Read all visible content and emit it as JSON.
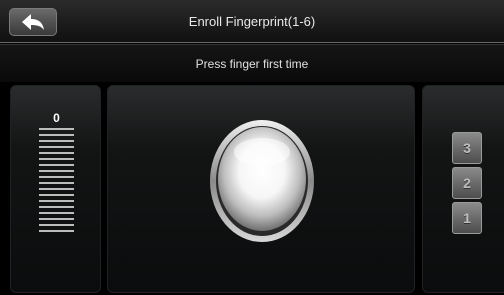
{
  "header": {
    "title": "Enroll Fingerprint(1-6)",
    "back_icon": "back-arrow-icon"
  },
  "prompt": {
    "text": "Press finger first time"
  },
  "quality": {
    "value": "0",
    "level": 0,
    "bar_count": 18,
    "bar_color": "#bcbcbc"
  },
  "sensor": {
    "icon": "fingerprint-sensor-icon"
  },
  "steps": {
    "items": [
      {
        "label": "3",
        "completed": false
      },
      {
        "label": "2",
        "completed": false
      },
      {
        "label": "1",
        "completed": false
      }
    ]
  },
  "colors": {
    "background": "#000000",
    "text": "#e8e8e8",
    "panel": "#131515"
  }
}
